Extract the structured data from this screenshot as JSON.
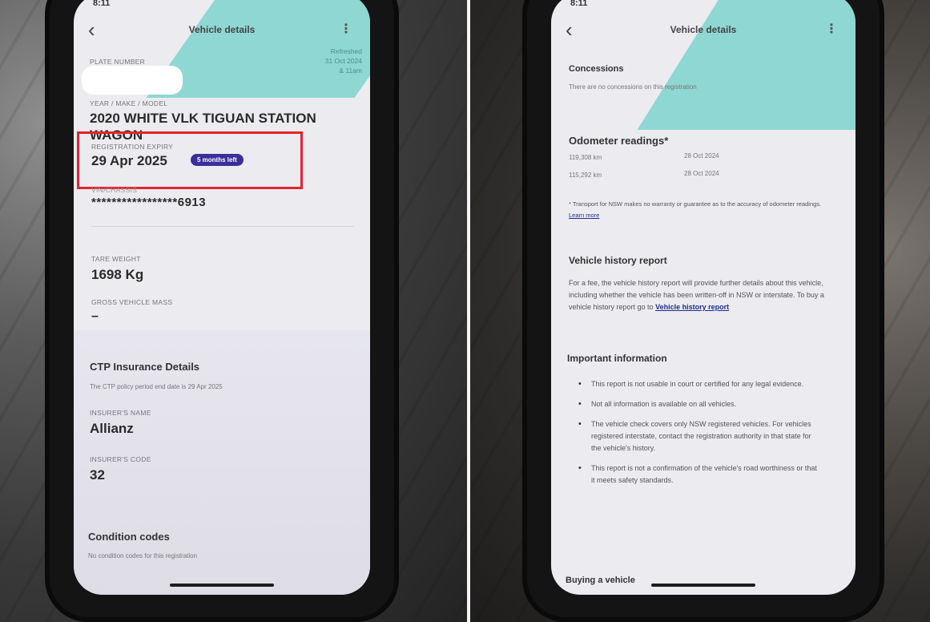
{
  "left_screen": {
    "status_time": "8:11",
    "back_icon": "‹",
    "title": "Vehicle details",
    "menu_icon": "⋮",
    "refreshed": [
      "Refreshed",
      "31 Oct 2024",
      "& 11am"
    ],
    "plate_label": "PLATE NUMBER",
    "ymm_label": "YEAR / MAKE / MODEL",
    "ymm_value": "2020 WHITE VLK TIGUAN STATION WAGON",
    "rego_expiry_label": "REGISTRATION EXPIRY",
    "rego_expiry_value": "29 Apr 2025",
    "months_left_badge": "5 months left",
    "vin_label": "VIN/CHASSIS",
    "vin_value": "*****************6913",
    "tare_label": "TARE WEIGHT",
    "tare_value": "1698 Kg",
    "gvm_label": "GROSS VEHICLE MASS",
    "gvm_value": "–",
    "ctp_heading": "CTP Insurance Details",
    "ctp_text": "The CTP policy period end date is 29 Apr 2025",
    "insurer_name_label": "INSURER'S NAME",
    "insurer_name_value": "Allianz",
    "insurer_code_label": "INSURER'S CODE",
    "insurer_code_value": "32",
    "condition_heading": "Condition codes",
    "condition_text": "No condition codes for this registration"
  },
  "right_screen": {
    "status_time": "8:11",
    "back_icon": "‹",
    "title": "Vehicle details",
    "menu_icon": "⋮",
    "concessions_heading": "Concessions",
    "concessions_text": "There are no concessions on this registration",
    "odometer_heading": "Odometer readings*",
    "odometer_rows": [
      {
        "reading": "119,308 km",
        "date": "28 Oct 2024"
      },
      {
        "reading": "115,292 km",
        "date": "28 Oct 2024"
      }
    ],
    "odometer_note": "* Transport for NSW makes no warranty or guarantee as to the accuracy of odometer readings.",
    "odometer_note_link": "Learn more",
    "history_heading": "Vehicle history report",
    "history_text": "For a fee, the vehicle history report will provide further details about this vehicle, including whether the vehicle has been written-off in NSW or interstate. To buy a vehicle history report go to",
    "history_link": "Vehicle history report",
    "important_heading": "Important information",
    "important_items": [
      "This report is not usable in court or certified for any legal evidence.",
      "Not all information is available on all vehicles.",
      "The vehicle check covers only NSW registered vehicles. For vehicles registered interstate, contact the registration authority in that state for the vehicle's history.",
      "This report is not a confirmation of the vehicle's road worthiness or that it meets safety standards."
    ],
    "buying_heading": "Buying a vehicle"
  },
  "colors": {
    "badge": "#3a2f9a",
    "highlight_box": "#e4242b",
    "accent_teal": "#7fd3cc",
    "link": "#1c2f8c"
  }
}
